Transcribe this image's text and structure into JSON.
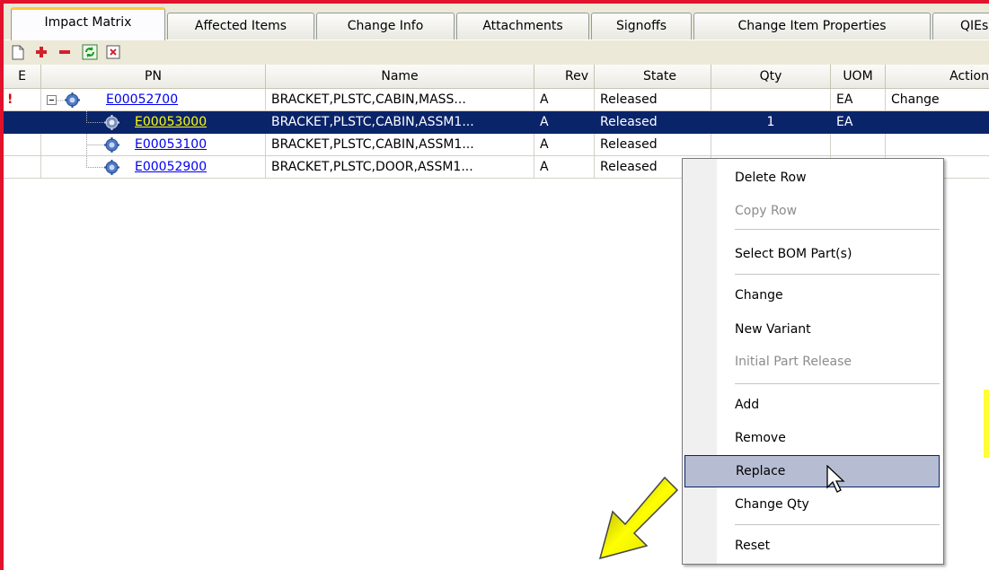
{
  "tabs": [
    {
      "label": "Impact Matrix",
      "active": true
    },
    {
      "label": "Affected Items"
    },
    {
      "label": "Change Info"
    },
    {
      "label": "Attachments"
    },
    {
      "label": "Signoffs"
    },
    {
      "label": "Change Item Properties"
    },
    {
      "label": "QIEs"
    }
  ],
  "toolbar": {
    "icons": [
      "new-doc-icon",
      "add-icon",
      "remove-icon",
      "refresh-icon",
      "delete-icon"
    ]
  },
  "grid": {
    "columns": [
      "E",
      "PN",
      "Name",
      "Rev",
      "State",
      "Qty",
      "UOM",
      "Action"
    ],
    "rows": [
      {
        "e": "!",
        "pn": "E00052700",
        "name": "BRACKET,PLSTC,CABIN,MASS...",
        "rev": "A",
        "state": "Released",
        "qty": "",
        "uom": "EA",
        "action": "Change"
      },
      {
        "e": "",
        "pn": "E00053000",
        "name": "BRACKET,PLSTC,CABIN,ASSM1...",
        "rev": "A",
        "state": "Released",
        "qty": "1",
        "uom": "EA",
        "action": "",
        "selected": true
      },
      {
        "e": "",
        "pn": "E00053100",
        "name": "BRACKET,PLSTC,CABIN,ASSM1...",
        "rev": "A",
        "state": "Released",
        "qty": "",
        "uom": "",
        "action": ""
      },
      {
        "e": "",
        "pn": "E00052900",
        "name": "BRACKET,PLSTC,DOOR,ASSM1...",
        "rev": "A",
        "state": "Released",
        "qty": "",
        "uom": "",
        "action": ""
      }
    ]
  },
  "context_menu": {
    "items": [
      {
        "label": "Delete Row"
      },
      {
        "label": "Copy Row",
        "disabled": true
      },
      {
        "label": "Select BOM Part(s)"
      },
      {
        "label": "Change"
      },
      {
        "label": "New Variant"
      },
      {
        "label": "Initial Part Release",
        "disabled": true
      },
      {
        "label": "Add"
      },
      {
        "label": "Remove"
      },
      {
        "label": "Replace",
        "hover": true
      },
      {
        "label": "Change Qty"
      },
      {
        "label": "Reset"
      }
    ]
  },
  "colors": {
    "accent_border": "#e0122c",
    "selection": "#0a246a",
    "link": "#0000ee",
    "annotation_arrow": "#e6e600"
  }
}
